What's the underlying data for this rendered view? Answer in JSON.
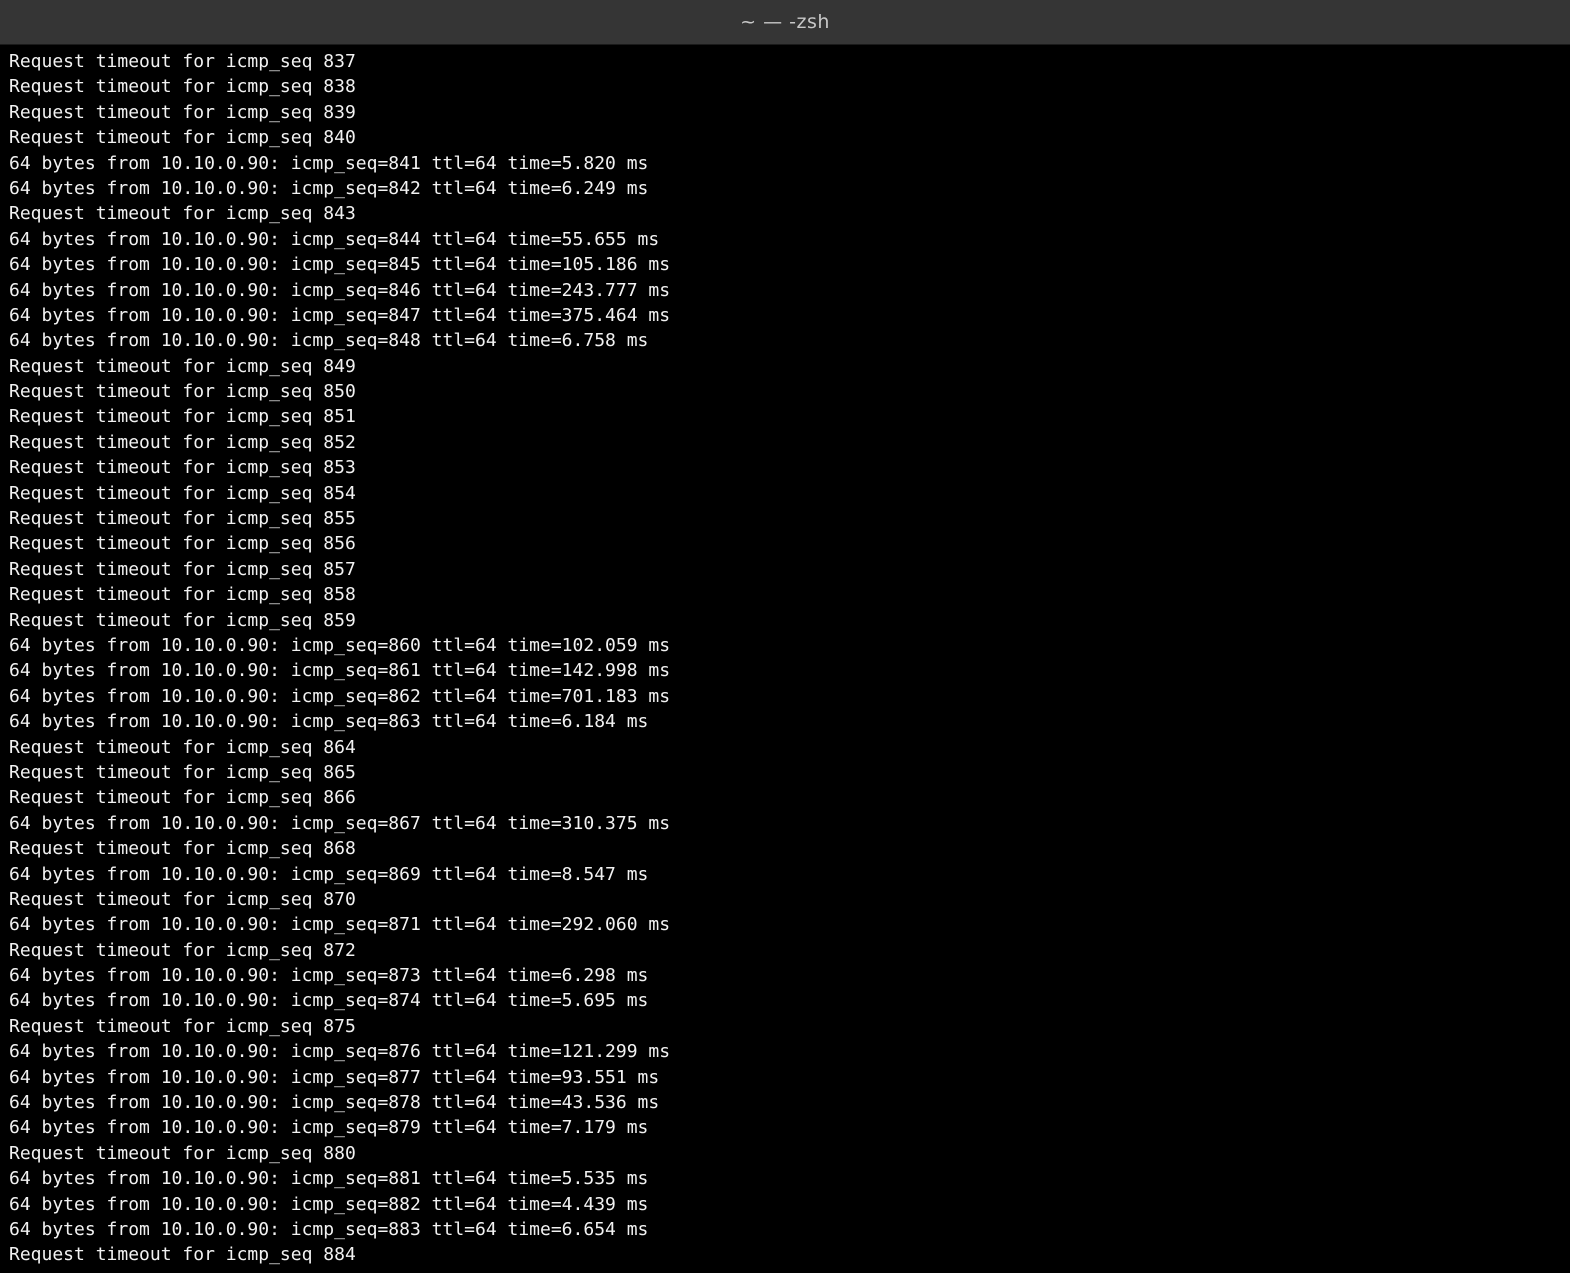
{
  "window": {
    "title": "~ — -zsh",
    "background_color": "#000000",
    "titlebar_color": "#353535",
    "text_color": "#f2f2f2"
  },
  "terminal": {
    "lines": [
      "Request timeout for icmp_seq 837",
      "Request timeout for icmp_seq 838",
      "Request timeout for icmp_seq 839",
      "Request timeout for icmp_seq 840",
      "64 bytes from 10.10.0.90: icmp_seq=841 ttl=64 time=5.820 ms",
      "64 bytes from 10.10.0.90: icmp_seq=842 ttl=64 time=6.249 ms",
      "Request timeout for icmp_seq 843",
      "64 bytes from 10.10.0.90: icmp_seq=844 ttl=64 time=55.655 ms",
      "64 bytes from 10.10.0.90: icmp_seq=845 ttl=64 time=105.186 ms",
      "64 bytes from 10.10.0.90: icmp_seq=846 ttl=64 time=243.777 ms",
      "64 bytes from 10.10.0.90: icmp_seq=847 ttl=64 time=375.464 ms",
      "64 bytes from 10.10.0.90: icmp_seq=848 ttl=64 time=6.758 ms",
      "Request timeout for icmp_seq 849",
      "Request timeout for icmp_seq 850",
      "Request timeout for icmp_seq 851",
      "Request timeout for icmp_seq 852",
      "Request timeout for icmp_seq 853",
      "Request timeout for icmp_seq 854",
      "Request timeout for icmp_seq 855",
      "Request timeout for icmp_seq 856",
      "Request timeout for icmp_seq 857",
      "Request timeout for icmp_seq 858",
      "Request timeout for icmp_seq 859",
      "64 bytes from 10.10.0.90: icmp_seq=860 ttl=64 time=102.059 ms",
      "64 bytes from 10.10.0.90: icmp_seq=861 ttl=64 time=142.998 ms",
      "64 bytes from 10.10.0.90: icmp_seq=862 ttl=64 time=701.183 ms",
      "64 bytes from 10.10.0.90: icmp_seq=863 ttl=64 time=6.184 ms",
      "Request timeout for icmp_seq 864",
      "Request timeout for icmp_seq 865",
      "Request timeout for icmp_seq 866",
      "64 bytes from 10.10.0.90: icmp_seq=867 ttl=64 time=310.375 ms",
      "Request timeout for icmp_seq 868",
      "64 bytes from 10.10.0.90: icmp_seq=869 ttl=64 time=8.547 ms",
      "Request timeout for icmp_seq 870",
      "64 bytes from 10.10.0.90: icmp_seq=871 ttl=64 time=292.060 ms",
      "Request timeout for icmp_seq 872",
      "64 bytes from 10.10.0.90: icmp_seq=873 ttl=64 time=6.298 ms",
      "64 bytes from 10.10.0.90: icmp_seq=874 ttl=64 time=5.695 ms",
      "Request timeout for icmp_seq 875",
      "64 bytes from 10.10.0.90: icmp_seq=876 ttl=64 time=121.299 ms",
      "64 bytes from 10.10.0.90: icmp_seq=877 ttl=64 time=93.551 ms",
      "64 bytes from 10.10.0.90: icmp_seq=878 ttl=64 time=43.536 ms",
      "64 bytes from 10.10.0.90: icmp_seq=879 ttl=64 time=7.179 ms",
      "Request timeout for icmp_seq 880",
      "64 bytes from 10.10.0.90: icmp_seq=881 ttl=64 time=5.535 ms",
      "64 bytes from 10.10.0.90: icmp_seq=882 ttl=64 time=4.439 ms",
      "64 bytes from 10.10.0.90: icmp_seq=883 ttl=64 time=6.654 ms",
      "Request timeout for icmp_seq 884"
    ]
  }
}
